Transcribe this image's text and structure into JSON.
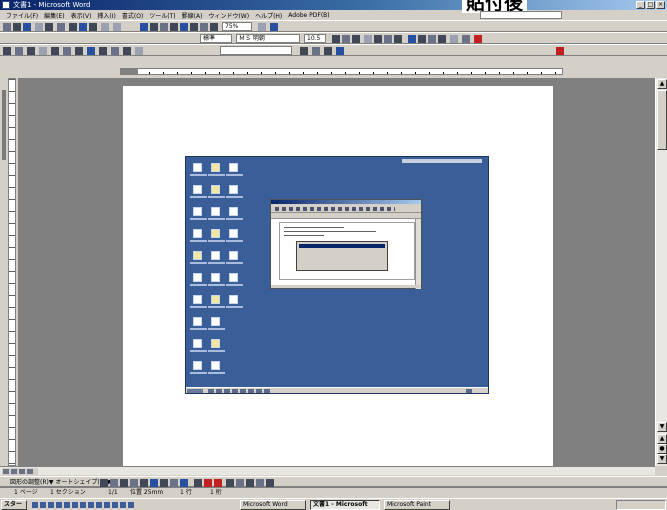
{
  "window": {
    "title": "文書1 - Microsoft Word",
    "overlay_label": "貼付後"
  },
  "menu": {
    "items": [
      "ファイル(F)",
      "編集(E)",
      "表示(V)",
      "挿入(I)",
      "書式(O)",
      "ツール(T)",
      "罫線(A)",
      "ウィンドウ(W)",
      "ヘルプ(H)",
      "Adobe PDF(B)"
    ]
  },
  "toolbar": {
    "zoom": "75%",
    "style": "標準",
    "font": "ＭＳ 明朝",
    "size": "10.5"
  },
  "drawing_toolbar": {
    "label": "図形の調整(R)▼  オートシェイプ(U)▼"
  },
  "statusbar": {
    "page": "1 ページ",
    "section": "1 セクション",
    "pagecount": "1/1",
    "position": "位置 25mm",
    "line": "1 行",
    "column": "1 桁"
  },
  "taskbar": {
    "start": "スタート",
    "tasks": [
      "Microsoft Word",
      "文書1 - Microsoft",
      "Microsoft Paint"
    ],
    "active_index": 1
  },
  "colors": {
    "desktop": "#3a5f98",
    "titlebar": "#0a246a"
  }
}
